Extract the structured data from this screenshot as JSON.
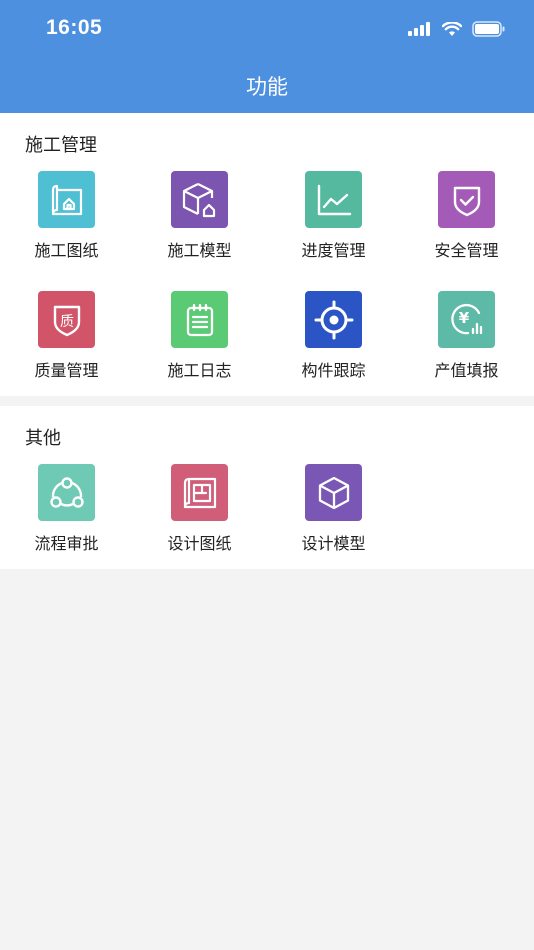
{
  "status_bar": {
    "time": "16:05"
  },
  "nav": {
    "title": "功能"
  },
  "sections": [
    {
      "title": "施工管理",
      "items": [
        {
          "label": "施工图纸",
          "icon": "blueprint-house-icon",
          "color": "#4fbfd3"
        },
        {
          "label": "施工模型",
          "icon": "cube-house-icon",
          "color": "#7c55b0"
        },
        {
          "label": "进度管理",
          "icon": "line-chart-icon",
          "color": "#55b9a0"
        },
        {
          "label": "安全管理",
          "icon": "shield-check-icon",
          "color": "#a45bb8"
        },
        {
          "label": "质量管理",
          "icon": "quality-shield-icon",
          "color": "#d15468"
        },
        {
          "label": "施工日志",
          "icon": "notebook-icon",
          "color": "#5acb74"
        },
        {
          "label": "构件跟踪",
          "icon": "target-icon",
          "color": "#2b55c5"
        },
        {
          "label": "产值填报",
          "icon": "yuan-chart-icon",
          "color": "#5dbaa6"
        }
      ]
    },
    {
      "title": "其他",
      "items": [
        {
          "label": "流程审批",
          "icon": "workflow-icon",
          "color": "#6ec9b5"
        },
        {
          "label": "设计图纸",
          "icon": "floorplan-icon",
          "color": "#d05e79"
        },
        {
          "label": "设计模型",
          "icon": "cube-icon",
          "color": "#7a57b4"
        }
      ]
    }
  ],
  "icon_glyph_text": {
    "quality": "质",
    "yuan": "¥"
  }
}
